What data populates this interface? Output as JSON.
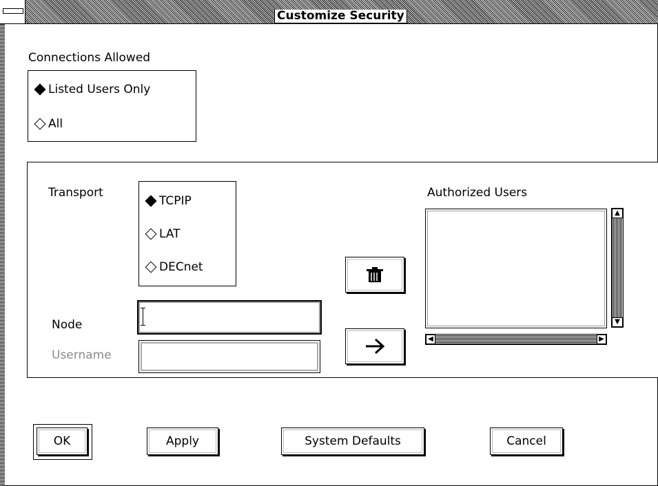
{
  "window": {
    "title": "Customize Security"
  },
  "connections": {
    "heading": "Connections Allowed",
    "options": [
      {
        "label": "Listed Users Only",
        "selected": true
      },
      {
        "label": "All",
        "selected": false
      }
    ]
  },
  "transport": {
    "heading": "Transport",
    "options": [
      {
        "label": "TCPIP",
        "selected": true
      },
      {
        "label": "LAT",
        "selected": false
      },
      {
        "label": "DECnet",
        "selected": false
      }
    ]
  },
  "node": {
    "label": "Node",
    "value": ""
  },
  "username": {
    "label": "Username",
    "value": "",
    "disabled": true
  },
  "authorized_users": {
    "heading": "Authorized Users",
    "items": []
  },
  "buttons": {
    "ok": "OK",
    "apply": "Apply",
    "system_defaults": "System Defaults",
    "cancel": "Cancel",
    "delete_icon": "trash-icon",
    "add_icon": "right-arrow-icon"
  }
}
